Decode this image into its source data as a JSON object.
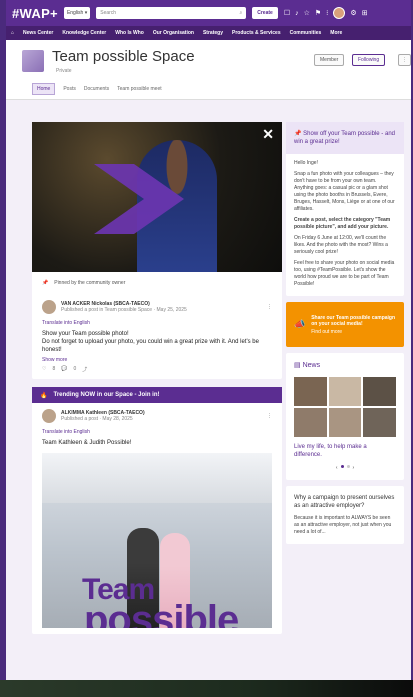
{
  "app": {
    "logo": "#WAP+",
    "language": "English",
    "search_placeholder": "Search",
    "create_label": "Create"
  },
  "nav": [
    "News Center",
    "Knowledge Center",
    "Who Is Who",
    "Our Organisation",
    "Strategy",
    "Products & Services",
    "Communities",
    "More"
  ],
  "header": {
    "title": "Team possible Space",
    "subtitle": "Private",
    "member_label": "Member",
    "following_label": "Following"
  },
  "tabs": [
    "Home",
    "Posts",
    "Documents",
    "Team possible meet"
  ],
  "pinned": {
    "label": "Pinned by the community owner"
  },
  "post1": {
    "author": "VAN ACKER Nickolas (SBCA-TAECO)",
    "meta": "Published a post in Team possible Space · May 25, 2025",
    "translate": "Translate into English",
    "text1": "Show your Team possible photo!",
    "text2": "Do not forget to upload your photo, you could win a great prize with it. And let's be honest!",
    "more": "Show more",
    "likes": "8",
    "comments": "0"
  },
  "trending": {
    "label": "Trending NOW in our Space - Join in!"
  },
  "post2": {
    "author": "ALKIMMA Kathleen (SBCA-TAECO)",
    "meta": "Published a post · May 28, 2025",
    "translate": "Translate into English",
    "text": "Team Kathleen & Judith Possible!",
    "big1": "Team",
    "big2": "possible"
  },
  "promo": {
    "title": "Show off your Team possible - and win a great prize!",
    "greeting": "Hello Inge!",
    "body": "Snap a fun photo with your colleagues – they don't have to be from your own team. Anything goes: a casual pic or a glam shot using the photo booths in Brussels, Evere, Bruges, Hasselt, Mons, Liège or at one of our affiliates.",
    "step1": "Create a post, select the category \"Team possible picture\", and add your picture.",
    "step2": "On Friday 6 June at 12:00, we'll count the likes. And the photo with the most? Wins a seriously cool prize!",
    "step3": "Feel free to share your photo on social media too, using #TeamPossible. Let's show the world how proud we are to be part of Team Possible!"
  },
  "orange": {
    "title": "Share our Team possible campaign on your social media!",
    "cta": "Find out more"
  },
  "news": {
    "title": "News",
    "caption": "Live my life, to help make a difference.",
    "page": "1"
  },
  "teaser": {
    "title": "Why a campaign to present ourselves as an attractive employer?",
    "body": "Because it is important to ALWAYS be seen as an attractive employer, not just when you need a lot of..."
  },
  "colors": {
    "brand": "#5b2d91",
    "accent": "#f39200"
  }
}
